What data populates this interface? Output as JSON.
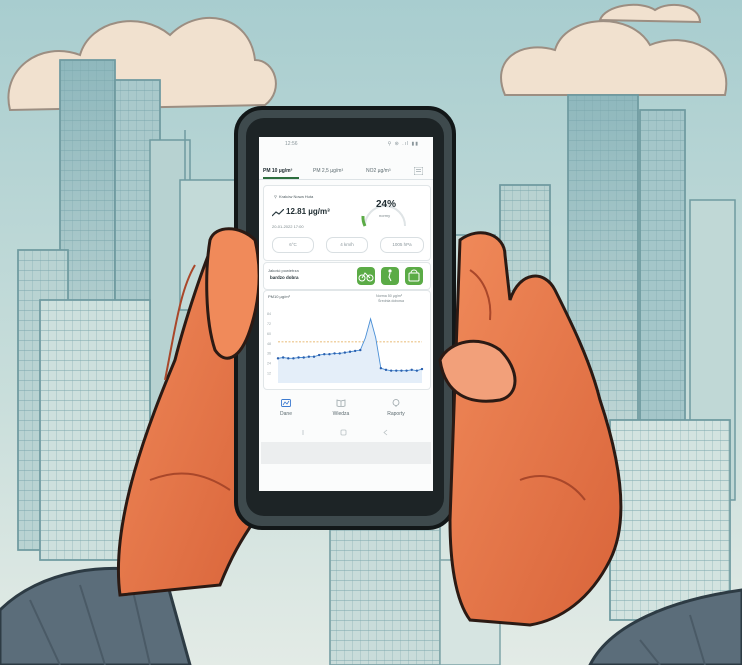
{
  "app": {
    "status_bar": {
      "time": "12:56",
      "icons": "⚲ ⊛ .ıl ▮▮"
    },
    "tabs": [
      {
        "label": "PM 10 µg/m³",
        "active": true
      },
      {
        "label": "PM 2,5 µg/m³",
        "active": false
      },
      {
        "label": "NO2 µg/m³",
        "active": false
      }
    ],
    "location_card": {
      "location": "Kraków Nowa Huta",
      "value": "12.81 µg/m³",
      "datetime": "20-01-2022 17:00",
      "percent": "24%",
      "percent_label": "normy",
      "pills": [
        "6°C",
        "4 km/h",
        "1005 hPa"
      ]
    },
    "quality_card": {
      "label": "Jakość powietrza",
      "status": "bardzo dobra"
    },
    "chart_card": {
      "title": "PM10 µg/m³",
      "note_line1": "Norma 50 µg/m³",
      "note_line2": "Średnia dobowa"
    },
    "nav": [
      {
        "label": "Dane",
        "icon": "chart-icon"
      },
      {
        "label": "Wiedza",
        "icon": "book-icon"
      },
      {
        "label": "Raporty",
        "icon": "map-pin-icon"
      }
    ]
  },
  "colors": {
    "accent_green": "#5bab46",
    "chart_line": "#4a8fd6",
    "chart_points": "#2b5fad",
    "gauge_track": "#dfe4e6",
    "gauge_fill": "#5bab46"
  },
  "chart_data": {
    "type": "line",
    "ylabel": "PM10 µg/m³",
    "ylim": [
      0,
      90
    ],
    "yticks": [
      12,
      24,
      36,
      48,
      60,
      72,
      84
    ],
    "threshold": 50,
    "series": [
      {
        "values": [
          30,
          31,
          30,
          30,
          31,
          31,
          32,
          32,
          34,
          35,
          35,
          36,
          36,
          37,
          38,
          39,
          40,
          55,
          78,
          55,
          18,
          16,
          15,
          15,
          15,
          15,
          16,
          15,
          17
        ]
      }
    ]
  }
}
